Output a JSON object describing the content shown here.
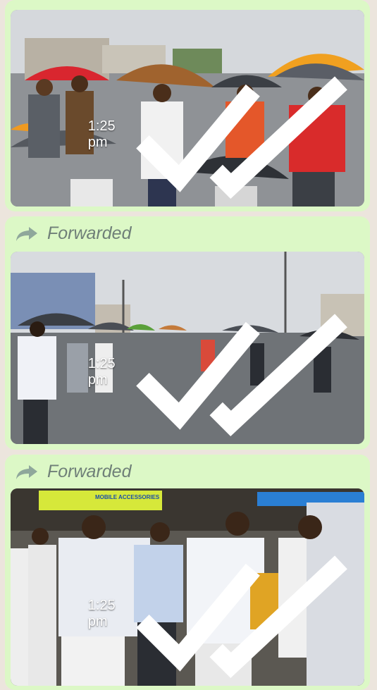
{
  "messages": [
    {
      "forwarded": false,
      "time": "1:25 pm"
    },
    {
      "forwarded": true,
      "forwarded_label": "Forwarded",
      "time": "1:25 pm"
    },
    {
      "forwarded": true,
      "forwarded_label": "Forwarded",
      "time": "1:25 pm"
    }
  ],
  "photo3": {
    "banner": "MOBILE ACCESSORIES"
  },
  "colors": {
    "bubble": "#dcf8c6",
    "background": "#ece5dd",
    "forwarded_text": "#6f7f78"
  },
  "icons": [
    "forward-arrow-icon",
    "double-check-icon"
  ]
}
